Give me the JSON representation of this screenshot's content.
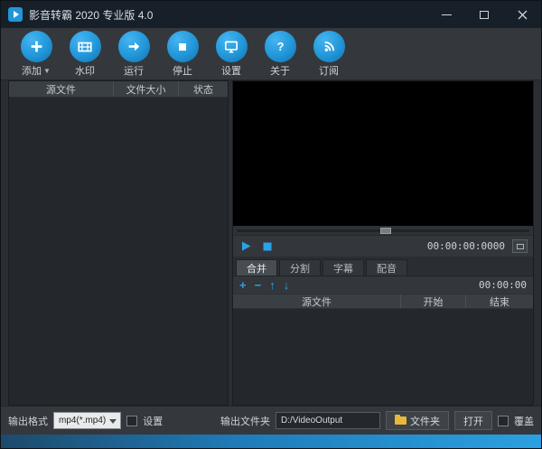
{
  "window": {
    "title": "影音转霸 2020 专业版 4.0"
  },
  "toolbar": {
    "buttons": [
      {
        "label": "添加",
        "icon": "add-plus-icon",
        "has_dropdown": true
      },
      {
        "label": "水印",
        "icon": "watermark-film-icon"
      },
      {
        "label": "运行",
        "icon": "run-arrow-icon"
      },
      {
        "label": "停止",
        "icon": "stop-square-icon"
      },
      {
        "label": "设置",
        "icon": "settings-monitor-icon"
      },
      {
        "label": "关于",
        "icon": "about-question-icon"
      },
      {
        "label": "订阅",
        "icon": "subscribe-rss-icon"
      }
    ]
  },
  "file_list": {
    "columns": [
      "源文件",
      "文件大小",
      "状态"
    ],
    "rows": []
  },
  "preview": {
    "time": "00:00:00:0000",
    "icons": {
      "play": "play-icon",
      "stop": "stop-icon",
      "snapshot": "snapshot-icon"
    }
  },
  "editor": {
    "tabs": [
      {
        "label": "合并",
        "active": true
      },
      {
        "label": "分割",
        "active": false
      },
      {
        "label": "字幕",
        "active": false
      },
      {
        "label": "配音",
        "active": false
      }
    ],
    "toolbar_icons": {
      "add": "+",
      "remove": "−",
      "move_up": "↑",
      "move_down": "↓"
    },
    "time": "00:00:00",
    "columns": [
      "源文件",
      "开始",
      "结束"
    ],
    "rows": []
  },
  "bottom_bar": {
    "output_format_label": "输出格式",
    "format_value": "mp4(*.mp4)",
    "settings_label": "设置",
    "output_folder_label": "输出文件夹",
    "output_folder_value": "D:/VideoOutput",
    "folder_button_label": "文件夹",
    "open_button_label": "打开",
    "overwrite_label": "覆盖"
  },
  "colors": {
    "accent_blue": "#2196d8",
    "titlebar": "#171f29",
    "toolbar_bg": "#34383c",
    "panel_dark": "#24272b",
    "folder_yellow": "#e9b83a"
  }
}
